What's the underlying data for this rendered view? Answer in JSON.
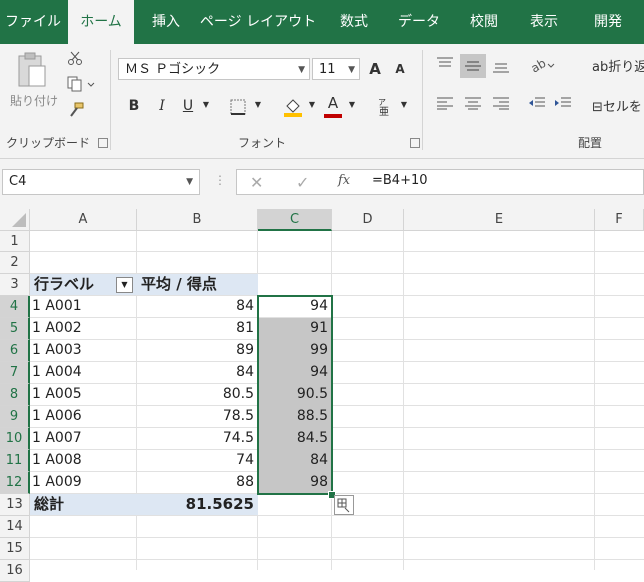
{
  "ribbon_tabs": [
    {
      "label": "ファイル"
    },
    {
      "label": "ホーム"
    },
    {
      "label": "挿入"
    },
    {
      "label": "ページ レイアウト"
    },
    {
      "label": "数式"
    },
    {
      "label": "データ"
    },
    {
      "label": "校閲"
    },
    {
      "label": "表示"
    },
    {
      "label": "開発"
    }
  ],
  "clipboard": {
    "paste_label": "貼り付け",
    "group_label": "クリップボード"
  },
  "font": {
    "name": "ＭＳ Ｐゴシック",
    "size": "11",
    "bold": "B",
    "italic": "I",
    "underline": "U",
    "group_label": "フォント",
    "grow": "A",
    "shrink": "A",
    "font_color_glyph": "A"
  },
  "alignment": {
    "wrap_label": "折り返",
    "merge_label": "セルを",
    "group_label": "配置"
  },
  "formula_bar": {
    "name_box": "C4",
    "formula": "=B4+10",
    "fx": "fx"
  },
  "columns": [
    "A",
    "B",
    "C",
    "D",
    "E",
    "F"
  ],
  "rows": [
    "1",
    "2",
    "3",
    "4",
    "5",
    "6",
    "7",
    "8",
    "9",
    "10",
    "11",
    "12",
    "13",
    "14",
    "15",
    "16"
  ],
  "pivot": {
    "header_row_label": "行ラベル",
    "header_value": "平均 / 得点",
    "items": [
      {
        "label": "1 A001",
        "value": "84",
        "c": "94"
      },
      {
        "label": "1 A002",
        "value": "81",
        "c": "91"
      },
      {
        "label": "1 A003",
        "value": "89",
        "c": "99"
      },
      {
        "label": "1 A004",
        "value": "84",
        "c": "94"
      },
      {
        "label": "1 A005",
        "value": "80.5",
        "c": "90.5"
      },
      {
        "label": "1 A006",
        "value": "78.5",
        "c": "88.5"
      },
      {
        "label": "1 A007",
        "value": "74.5",
        "c": "84.5"
      },
      {
        "label": "1 A008",
        "value": "74",
        "c": "84"
      },
      {
        "label": "1 A009",
        "value": "88",
        "c": "98"
      }
    ],
    "total_label": "総計",
    "total_value": "81.5625"
  },
  "colors": {
    "accent": "#217346",
    "pivot_fill": "#dde7f3",
    "selection_fill": "#c6c6c6"
  }
}
